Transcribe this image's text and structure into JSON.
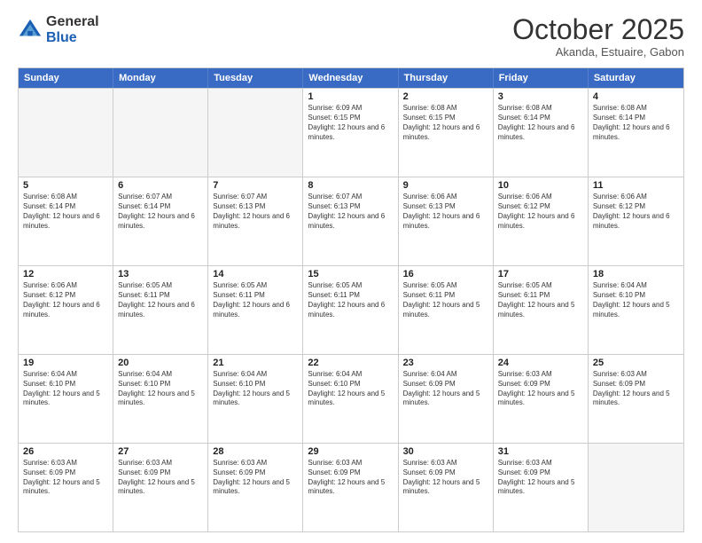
{
  "logo": {
    "general": "General",
    "blue": "Blue"
  },
  "header": {
    "month": "October 2025",
    "location": "Akanda, Estuaire, Gabon"
  },
  "weekdays": [
    "Sunday",
    "Monday",
    "Tuesday",
    "Wednesday",
    "Thursday",
    "Friday",
    "Saturday"
  ],
  "rows": [
    [
      {
        "day": "",
        "sunrise": "",
        "sunset": "",
        "daylight": "",
        "empty": true
      },
      {
        "day": "",
        "sunrise": "",
        "sunset": "",
        "daylight": "",
        "empty": true
      },
      {
        "day": "",
        "sunrise": "",
        "sunset": "",
        "daylight": "",
        "empty": true
      },
      {
        "day": "1",
        "sunrise": "Sunrise: 6:09 AM",
        "sunset": "Sunset: 6:15 PM",
        "daylight": "Daylight: 12 hours and 6 minutes."
      },
      {
        "day": "2",
        "sunrise": "Sunrise: 6:08 AM",
        "sunset": "Sunset: 6:15 PM",
        "daylight": "Daylight: 12 hours and 6 minutes."
      },
      {
        "day": "3",
        "sunrise": "Sunrise: 6:08 AM",
        "sunset": "Sunset: 6:14 PM",
        "daylight": "Daylight: 12 hours and 6 minutes."
      },
      {
        "day": "4",
        "sunrise": "Sunrise: 6:08 AM",
        "sunset": "Sunset: 6:14 PM",
        "daylight": "Daylight: 12 hours and 6 minutes."
      }
    ],
    [
      {
        "day": "5",
        "sunrise": "Sunrise: 6:08 AM",
        "sunset": "Sunset: 6:14 PM",
        "daylight": "Daylight: 12 hours and 6 minutes."
      },
      {
        "day": "6",
        "sunrise": "Sunrise: 6:07 AM",
        "sunset": "Sunset: 6:14 PM",
        "daylight": "Daylight: 12 hours and 6 minutes."
      },
      {
        "day": "7",
        "sunrise": "Sunrise: 6:07 AM",
        "sunset": "Sunset: 6:13 PM",
        "daylight": "Daylight: 12 hours and 6 minutes."
      },
      {
        "day": "8",
        "sunrise": "Sunrise: 6:07 AM",
        "sunset": "Sunset: 6:13 PM",
        "daylight": "Daylight: 12 hours and 6 minutes."
      },
      {
        "day": "9",
        "sunrise": "Sunrise: 6:06 AM",
        "sunset": "Sunset: 6:13 PM",
        "daylight": "Daylight: 12 hours and 6 minutes."
      },
      {
        "day": "10",
        "sunrise": "Sunrise: 6:06 AM",
        "sunset": "Sunset: 6:12 PM",
        "daylight": "Daylight: 12 hours and 6 minutes."
      },
      {
        "day": "11",
        "sunrise": "Sunrise: 6:06 AM",
        "sunset": "Sunset: 6:12 PM",
        "daylight": "Daylight: 12 hours and 6 minutes."
      }
    ],
    [
      {
        "day": "12",
        "sunrise": "Sunrise: 6:06 AM",
        "sunset": "Sunset: 6:12 PM",
        "daylight": "Daylight: 12 hours and 6 minutes."
      },
      {
        "day": "13",
        "sunrise": "Sunrise: 6:05 AM",
        "sunset": "Sunset: 6:11 PM",
        "daylight": "Daylight: 12 hours and 6 minutes."
      },
      {
        "day": "14",
        "sunrise": "Sunrise: 6:05 AM",
        "sunset": "Sunset: 6:11 PM",
        "daylight": "Daylight: 12 hours and 6 minutes."
      },
      {
        "day": "15",
        "sunrise": "Sunrise: 6:05 AM",
        "sunset": "Sunset: 6:11 PM",
        "daylight": "Daylight: 12 hours and 6 minutes."
      },
      {
        "day": "16",
        "sunrise": "Sunrise: 6:05 AM",
        "sunset": "Sunset: 6:11 PM",
        "daylight": "Daylight: 12 hours and 5 minutes."
      },
      {
        "day": "17",
        "sunrise": "Sunrise: 6:05 AM",
        "sunset": "Sunset: 6:11 PM",
        "daylight": "Daylight: 12 hours and 5 minutes."
      },
      {
        "day": "18",
        "sunrise": "Sunrise: 6:04 AM",
        "sunset": "Sunset: 6:10 PM",
        "daylight": "Daylight: 12 hours and 5 minutes."
      }
    ],
    [
      {
        "day": "19",
        "sunrise": "Sunrise: 6:04 AM",
        "sunset": "Sunset: 6:10 PM",
        "daylight": "Daylight: 12 hours and 5 minutes."
      },
      {
        "day": "20",
        "sunrise": "Sunrise: 6:04 AM",
        "sunset": "Sunset: 6:10 PM",
        "daylight": "Daylight: 12 hours and 5 minutes."
      },
      {
        "day": "21",
        "sunrise": "Sunrise: 6:04 AM",
        "sunset": "Sunset: 6:10 PM",
        "daylight": "Daylight: 12 hours and 5 minutes."
      },
      {
        "day": "22",
        "sunrise": "Sunrise: 6:04 AM",
        "sunset": "Sunset: 6:10 PM",
        "daylight": "Daylight: 12 hours and 5 minutes."
      },
      {
        "day": "23",
        "sunrise": "Sunrise: 6:04 AM",
        "sunset": "Sunset: 6:09 PM",
        "daylight": "Daylight: 12 hours and 5 minutes."
      },
      {
        "day": "24",
        "sunrise": "Sunrise: 6:03 AM",
        "sunset": "Sunset: 6:09 PM",
        "daylight": "Daylight: 12 hours and 5 minutes."
      },
      {
        "day": "25",
        "sunrise": "Sunrise: 6:03 AM",
        "sunset": "Sunset: 6:09 PM",
        "daylight": "Daylight: 12 hours and 5 minutes."
      }
    ],
    [
      {
        "day": "26",
        "sunrise": "Sunrise: 6:03 AM",
        "sunset": "Sunset: 6:09 PM",
        "daylight": "Daylight: 12 hours and 5 minutes."
      },
      {
        "day": "27",
        "sunrise": "Sunrise: 6:03 AM",
        "sunset": "Sunset: 6:09 PM",
        "daylight": "Daylight: 12 hours and 5 minutes."
      },
      {
        "day": "28",
        "sunrise": "Sunrise: 6:03 AM",
        "sunset": "Sunset: 6:09 PM",
        "daylight": "Daylight: 12 hours and 5 minutes."
      },
      {
        "day": "29",
        "sunrise": "Sunrise: 6:03 AM",
        "sunset": "Sunset: 6:09 PM",
        "daylight": "Daylight: 12 hours and 5 minutes."
      },
      {
        "day": "30",
        "sunrise": "Sunrise: 6:03 AM",
        "sunset": "Sunset: 6:09 PM",
        "daylight": "Daylight: 12 hours and 5 minutes."
      },
      {
        "day": "31",
        "sunrise": "Sunrise: 6:03 AM",
        "sunset": "Sunset: 6:09 PM",
        "daylight": "Daylight: 12 hours and 5 minutes."
      },
      {
        "day": "",
        "sunrise": "",
        "sunset": "",
        "daylight": "",
        "empty": true
      }
    ]
  ]
}
